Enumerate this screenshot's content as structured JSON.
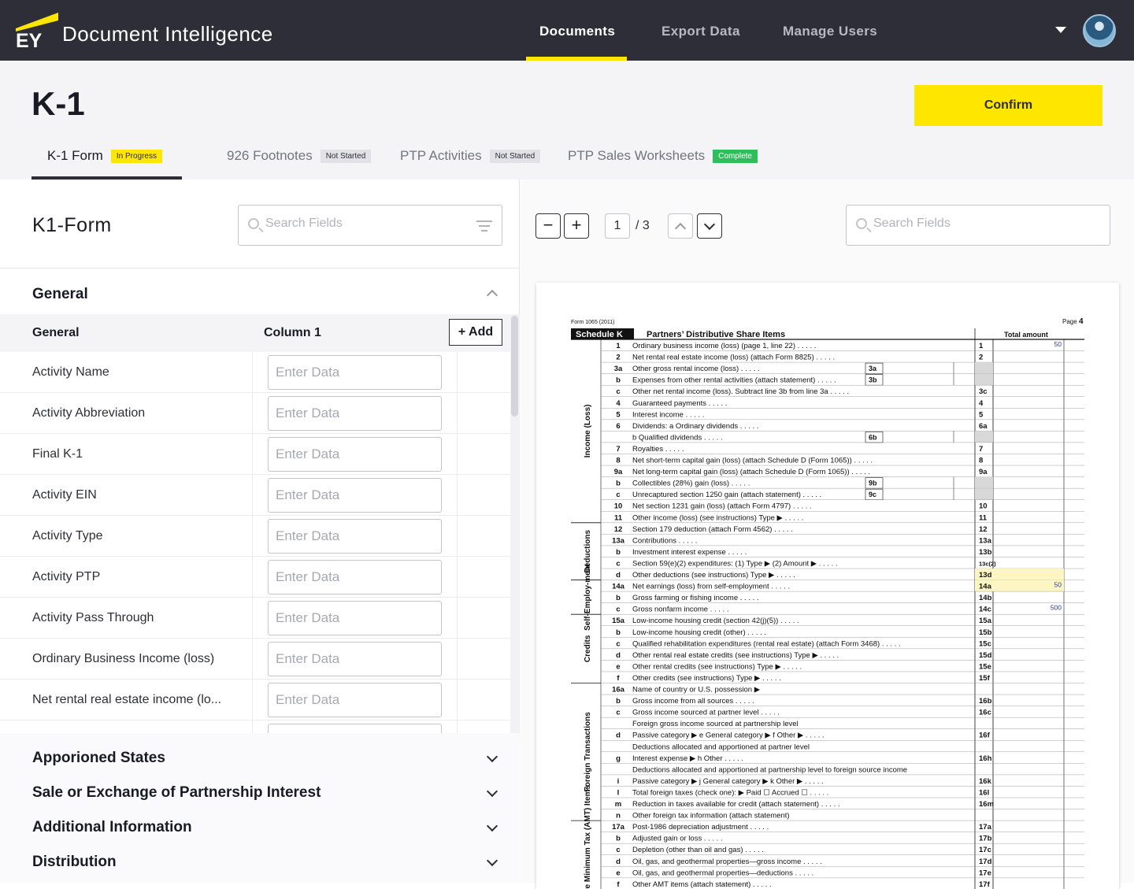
{
  "app": {
    "brand": "EY",
    "title": "Document Intelligence"
  },
  "nav": {
    "items": [
      {
        "label": "Documents"
      },
      {
        "label": "Export Data"
      },
      {
        "label": "Manage Users"
      }
    ]
  },
  "page": {
    "title": "K-1",
    "confirm_label": "Confirm"
  },
  "tabs": [
    {
      "label": "K-1 Form",
      "status": "In Progress"
    },
    {
      "label": "926 Footnotes",
      "status": "Not Started"
    },
    {
      "label": "PTP Activities",
      "status": "Not Started"
    },
    {
      "label": "PTP Sales Worksheets",
      "status": "Complete"
    }
  ],
  "left": {
    "title": "K1-Form",
    "search_placeholder": "Search Fields",
    "section_title": "General",
    "table": {
      "col_a": "General",
      "col_b": "Column 1",
      "add_label": "+ Add",
      "input_placeholder": "Enter Data"
    },
    "rows": [
      "Activity Name",
      "Activity Abbreviation",
      "Final K-1",
      "Activity EIN",
      "Activity Type",
      "Activity PTP",
      "Activity Pass Through",
      "Ordinary Business Income (loss)",
      "Net rental real estate income (lo..."
    ],
    "collapsed_sections": [
      "Apporioned States",
      "Sale or Exchange of Partnership Interest",
      "Additional Information",
      "Distribution"
    ]
  },
  "viewer": {
    "page_current": "1",
    "page_total": "/ 3",
    "search_placeholder": "Search Fields",
    "doc": {
      "form_id": "Form 1065 (2011)",
      "page_label": "Page",
      "page_num": "4",
      "schedule": "Schedule K",
      "schedule_title": "Partners’ Distributive Share Items",
      "total_header": "Total amount",
      "groups": [
        "Income (Loss)",
        "Deductions",
        "Self-Employ-ment",
        "Credits",
        "Foreign Transactions",
        "Alternative Minimum Tax (AMT) Items"
      ],
      "lines": [
        {
          "n": "1",
          "t": "Ordinary business income (loss) (page 1, line 22)",
          "box": "1",
          "amt": "50"
        },
        {
          "n": "2",
          "t": "Net rental real estate income (loss) (attach Form 8825)",
          "box": "2"
        },
        {
          "n": "3a",
          "t": "Other gross rental income (loss)",
          "sub": "3a"
        },
        {
          "n": "b",
          "t": "Expenses from other rental activities (attach statement)",
          "sub": "3b"
        },
        {
          "n": "c",
          "t": "Other net rental income (loss). Subtract line 3b from line 3a",
          "box": "3c"
        },
        {
          "n": "4",
          "t": "Guaranteed payments",
          "box": "4"
        },
        {
          "n": "5",
          "t": "Interest income",
          "box": "5"
        },
        {
          "n": "6",
          "t": "Dividends:   a   Ordinary dividends",
          "box": "6a"
        },
        {
          "n": "",
          "t": "                  b   Qualified dividends",
          "sub": "6b"
        },
        {
          "n": "7",
          "t": "Royalties",
          "box": "7"
        },
        {
          "n": "8",
          "t": "Net short-term capital gain (loss) (attach Schedule D (Form 1065))",
          "box": "8"
        },
        {
          "n": "9a",
          "t": "Net long-term capital gain (loss) (attach Schedule D (Form 1065))",
          "box": "9a"
        },
        {
          "n": "b",
          "t": "Collectibles (28%) gain (loss)",
          "sub": "9b"
        },
        {
          "n": "c",
          "t": "Unrecaptured section 1250 gain (attach statement)",
          "sub": "9c"
        },
        {
          "n": "10",
          "t": "Net section 1231 gain (loss) (attach Form 4797)",
          "box": "10"
        },
        {
          "n": "11",
          "t": "Other income (loss) (see instructions)   Type ▶",
          "box": "11"
        },
        {
          "n": "12",
          "t": "Section 179 deduction (attach Form 4562)",
          "box": "12"
        },
        {
          "n": "13a",
          "t": "Contributions",
          "box": "13a"
        },
        {
          "n": "b",
          "t": "Investment interest expense",
          "box": "13b"
        },
        {
          "n": "c",
          "t": "Section 59(e)(2) expenditures:      (1)  Type ▶                               (2)  Amount ▶",
          "box": "13c(2)"
        },
        {
          "n": "d",
          "t": "Other deductions (see instructions)    Type ▶",
          "box": "13d"
        },
        {
          "n": "14a",
          "t": "Net earnings (loss) from self-employment",
          "box": "14a",
          "amt": "50"
        },
        {
          "n": "b",
          "t": "Gross farming or fishing income",
          "box": "14b"
        },
        {
          "n": "c",
          "t": "Gross nonfarm income",
          "box": "14c",
          "amt": "500"
        },
        {
          "n": "15a",
          "t": "Low-income housing credit (section 42(j)(5))",
          "box": "15a"
        },
        {
          "n": "b",
          "t": "Low-income housing credit (other)",
          "box": "15b"
        },
        {
          "n": "c",
          "t": "Qualified rehabilitation expenditures (rental real estate) (attach Form 3468)",
          "box": "15c"
        },
        {
          "n": "d",
          "t": "Other rental real estate credits (see instructions)          Type ▶",
          "box": "15d"
        },
        {
          "n": "e",
          "t": "Other rental credits (see instructions)                         Type ▶",
          "box": "15e"
        },
        {
          "n": "f",
          "t": "Other credits (see instructions)                                   Type ▶",
          "box": "15f"
        },
        {
          "n": "16a",
          "t": "Name of country or U.S. possession ▶"
        },
        {
          "n": "b",
          "t": "Gross income from all sources",
          "box": "16b"
        },
        {
          "n": "c",
          "t": "Gross income sourced at partner level",
          "box": "16c"
        },
        {
          "n": "",
          "t": "Foreign gross income sourced at partnership level"
        },
        {
          "n": "d",
          "t": "Passive category ▶                           e  General category ▶                        f  Other ▶",
          "box": "16f"
        },
        {
          "n": "",
          "t": "Deductions allocated and apportioned at partner level"
        },
        {
          "n": "g",
          "t": "Interest expense ▶                                   h  Other",
          "box": "16h"
        },
        {
          "n": "",
          "t": "Deductions allocated and apportioned at partnership level to foreign source income"
        },
        {
          "n": "i",
          "t": "Passive category ▶                            j  General category ▶                   k  Other ▶",
          "box": "16k"
        },
        {
          "n": "l",
          "t": "Total foreign taxes (check one): ▶   Paid  ☐     Accrued   ☐",
          "box": "16l"
        },
        {
          "n": "m",
          "t": "Reduction in taxes available for credit (attach statement)",
          "box": "16m"
        },
        {
          "n": "n",
          "t": "Other foreign tax information (attach statement)"
        },
        {
          "n": "17a",
          "t": "Post-1986 depreciation adjustment",
          "box": "17a"
        },
        {
          "n": "b",
          "t": "Adjusted gain or loss",
          "box": "17b"
        },
        {
          "n": "c",
          "t": "Depletion (other than oil and gas)",
          "box": "17c"
        },
        {
          "n": "d",
          "t": "Oil, gas, and geothermal properties—gross income",
          "box": "17d"
        },
        {
          "n": "e",
          "t": "Oil, gas, and geothermal properties—deductions",
          "box": "17e"
        },
        {
          "n": "f",
          "t": "Other AMT items (attach statement)",
          "box": "17f"
        }
      ]
    }
  },
  "colors": {
    "brand_yellow": "#ffe600",
    "topbar": "#2e2e38",
    "complete_green": "#2dbf5a",
    "highlight": "#fdf6c2"
  }
}
